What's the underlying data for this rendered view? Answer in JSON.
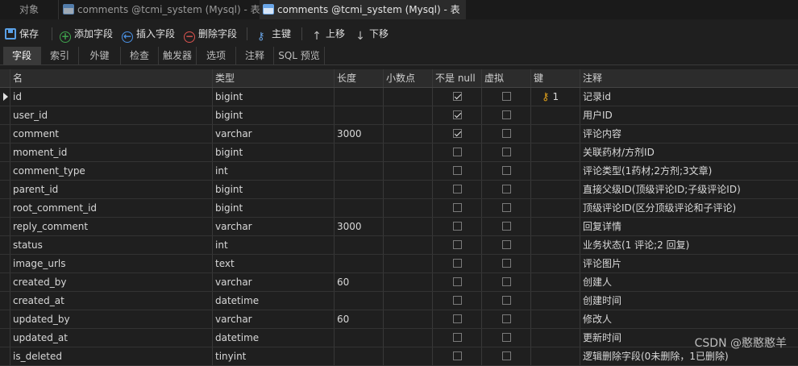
{
  "window_tabs": [
    {
      "label": "对象"
    },
    {
      "label": "comments @tcmi_system (Mysql) - 表"
    },
    {
      "label": "comments @tcmi_system (Mysql) - 表"
    }
  ],
  "toolbar": {
    "save": "保存",
    "add_field": "添加字段",
    "insert_field": "插入字段",
    "delete_field": "删除字段",
    "primary_key": "主键",
    "move_up": "上移",
    "move_down": "下移"
  },
  "sub_tabs": [
    "字段",
    "索引",
    "外键",
    "检查",
    "触发器",
    "选项",
    "注释",
    "SQL 预览"
  ],
  "active_sub_tab": "字段",
  "columns": {
    "name": "名",
    "type": "类型",
    "length": "长度",
    "decimal": "小数点",
    "not_null": "不是 null",
    "virtual": "虚拟",
    "key": "键",
    "comment": "注释"
  },
  "rows": [
    {
      "name": "id",
      "type": "bigint",
      "length": "",
      "decimal": "",
      "not_null": true,
      "virtual": false,
      "key": "1",
      "comment": "记录id"
    },
    {
      "name": "user_id",
      "type": "bigint",
      "length": "",
      "decimal": "",
      "not_null": true,
      "virtual": false,
      "key": "",
      "comment": "用户ID"
    },
    {
      "name": "comment",
      "type": "varchar",
      "length": "3000",
      "decimal": "",
      "not_null": true,
      "virtual": false,
      "key": "",
      "comment": "评论内容"
    },
    {
      "name": "moment_id",
      "type": "bigint",
      "length": "",
      "decimal": "",
      "not_null": false,
      "virtual": false,
      "key": "",
      "comment": "关联药材/方剂ID"
    },
    {
      "name": "comment_type",
      "type": "int",
      "length": "",
      "decimal": "",
      "not_null": false,
      "virtual": false,
      "key": "",
      "comment": "评论类型(1药材;2方剂;3文章)"
    },
    {
      "name": "parent_id",
      "type": "bigint",
      "length": "",
      "decimal": "",
      "not_null": false,
      "virtual": false,
      "key": "",
      "comment": "直接父级ID(顶级评论ID;子级评论ID)"
    },
    {
      "name": "root_comment_id",
      "type": "bigint",
      "length": "",
      "decimal": "",
      "not_null": false,
      "virtual": false,
      "key": "",
      "comment": "顶级评论ID(区分顶级评论和子评论)"
    },
    {
      "name": "reply_comment",
      "type": "varchar",
      "length": "3000",
      "decimal": "",
      "not_null": false,
      "virtual": false,
      "key": "",
      "comment": "回复详情"
    },
    {
      "name": "status",
      "type": "int",
      "length": "",
      "decimal": "",
      "not_null": false,
      "virtual": false,
      "key": "",
      "comment": "业务状态(1 评论;2 回复)"
    },
    {
      "name": "image_urls",
      "type": "text",
      "length": "",
      "decimal": "",
      "not_null": false,
      "virtual": false,
      "key": "",
      "comment": "评论图片"
    },
    {
      "name": "created_by",
      "type": "varchar",
      "length": "60",
      "decimal": "",
      "not_null": false,
      "virtual": false,
      "key": "",
      "comment": "创建人"
    },
    {
      "name": "created_at",
      "type": "datetime",
      "length": "",
      "decimal": "",
      "not_null": false,
      "virtual": false,
      "key": "",
      "comment": "创建时间"
    },
    {
      "name": "updated_by",
      "type": "varchar",
      "length": "60",
      "decimal": "",
      "not_null": false,
      "virtual": false,
      "key": "",
      "comment": "修改人"
    },
    {
      "name": "updated_at",
      "type": "datetime",
      "length": "",
      "decimal": "",
      "not_null": false,
      "virtual": false,
      "key": "",
      "comment": "更新时间"
    },
    {
      "name": "is_deleted",
      "type": "tinyint",
      "length": "",
      "decimal": "",
      "not_null": false,
      "virtual": false,
      "key": "",
      "comment": "逻辑删除字段(0未删除，1已删除)"
    }
  ],
  "watermark": "CSDN @憨憨憨羊",
  "icons": {
    "save": "save-icon",
    "add": "plus-circle-icon",
    "insert": "insert-circle-icon",
    "delete": "minus-circle-icon",
    "key": "key-icon",
    "up": "arrow-up-icon",
    "down": "arrow-down-icon"
  }
}
